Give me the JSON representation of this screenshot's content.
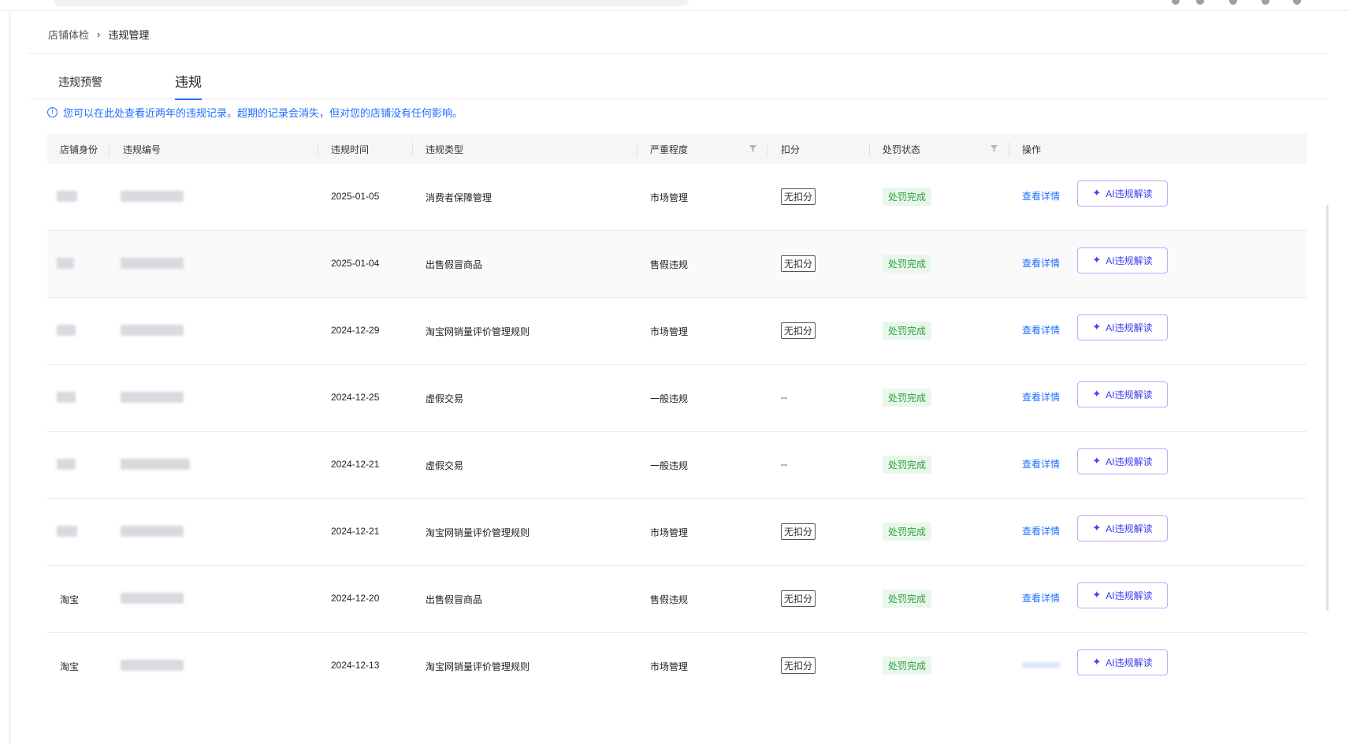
{
  "breadcrumb": {
    "parent": "店铺体检",
    "separator": "›",
    "current": "违规管理"
  },
  "tabs": [
    {
      "label": "违规预警",
      "active": false
    },
    {
      "label": "违规",
      "active": true
    }
  ],
  "notice": {
    "icon": "info-icon",
    "text": "您可以在此处查看近两年的违规记录。超期的记录会消失，但对您的店铺没有任何影响。"
  },
  "table": {
    "headers": [
      "店铺身份",
      "违规编号",
      "违规时间",
      "违规类型",
      "严重程度",
      "扣分",
      "处罚状态",
      "操作"
    ],
    "rows": [
      {
        "identity": "",
        "violation_id": "",
        "time": "2025-01-05",
        "type": "消费者保障管理",
        "severity": "市场管理",
        "score": "无扣分",
        "status": "处罚完成",
        "detail": "查看详情",
        "ai": "AI违规解读"
      },
      {
        "identity": "",
        "violation_id": "",
        "time": "2025-01-04",
        "type": "出售假冒商品",
        "severity": "售假违规",
        "score": "无扣分",
        "status": "处罚完成",
        "detail": "查看详情",
        "ai": "AI违规解读"
      },
      {
        "identity": "",
        "violation_id": "",
        "time": "2024-12-29",
        "type": "淘宝网销量评价管理规则",
        "severity": "市场管理",
        "score": "无扣分",
        "status": "处罚完成",
        "detail": "查看详情",
        "ai": "AI违规解读"
      },
      {
        "identity": "",
        "violation_id": "",
        "time": "2024-12-25",
        "type": "虚假交易",
        "severity": "一般违规",
        "score": "--",
        "status": "处罚完成",
        "detail": "查看详情",
        "ai": "AI违规解读"
      },
      {
        "identity": "",
        "violation_id": "",
        "time": "2024-12-21",
        "type": "虚假交易",
        "severity": "一般违规",
        "score": "--",
        "status": "处罚完成",
        "detail": "查看详情",
        "ai": "AI违规解读"
      },
      {
        "identity": "",
        "violation_id": "",
        "time": "2024-12-21",
        "type": "淘宝网销量评价管理规则",
        "severity": "市场管理",
        "score": "无扣分",
        "status": "处罚完成",
        "detail": "查看详情",
        "ai": "AI违规解读"
      },
      {
        "identity": "淘宝",
        "violation_id": "",
        "time": "2024-12-20",
        "type": "出售假冒商品",
        "severity": "售假违规",
        "score": "无扣分",
        "status": "处罚完成",
        "detail": "查看详情",
        "ai": "AI违规解读"
      },
      {
        "identity": "淘宝",
        "violation_id": "",
        "time": "2024-12-13",
        "type": "淘宝网销量评价管理规则",
        "severity": "市场管理",
        "score": "无扣分",
        "status": "处罚完成",
        "detail": "",
        "ai": "AI违规解读"
      }
    ]
  },
  "colors": {
    "accent": "#1f6fff",
    "status_bg": "#e8f7ea",
    "status_text": "#2ea043",
    "ai_border": "#c7a3ff"
  }
}
